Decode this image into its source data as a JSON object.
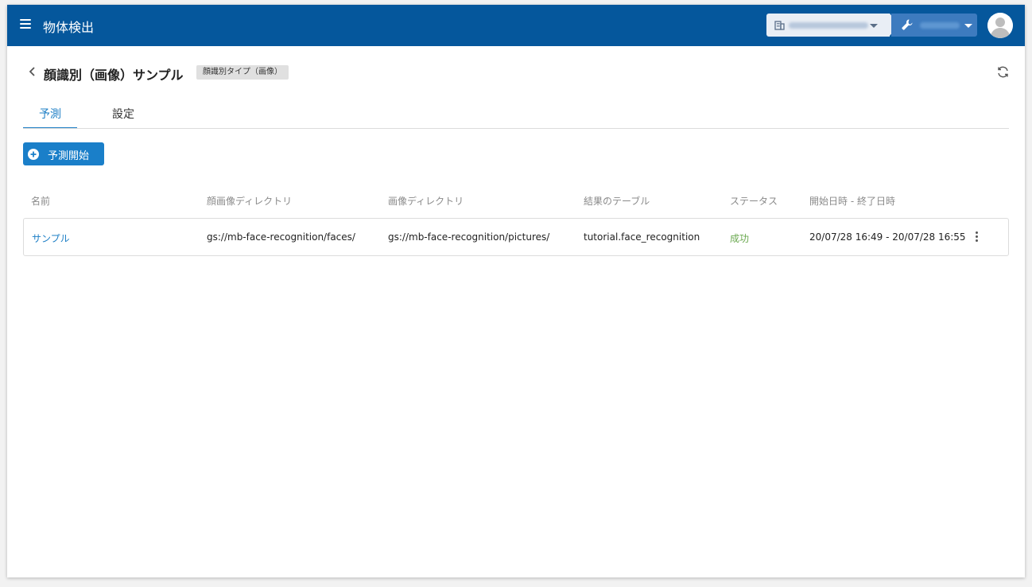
{
  "appbar": {
    "title": "物体検出",
    "icons": {
      "menu": "menu-icon",
      "org": "building-icon",
      "project": "wrench-icon",
      "avatar": "avatar-icon"
    },
    "colors": {
      "bar": "#05579c",
      "project_selector": "#3d7bbf"
    }
  },
  "page": {
    "title": "顔識別（画像）サンプル",
    "type_badge": "顔識別タイプ（画像）"
  },
  "tabs": [
    {
      "label": "予測",
      "active": true
    },
    {
      "label": "設定",
      "active": false
    }
  ],
  "actions": {
    "start_label": "予測開始"
  },
  "table": {
    "columns": [
      "名前",
      "顔画像ディレクトリ",
      "画像ディレクトリ",
      "結果のテーブル",
      "ステータス",
      "開始日時 - 終了日時"
    ],
    "rows": [
      {
        "name": "サンプル",
        "face_dir": "gs://mb-face-recognition/faces/",
        "image_dir": "gs://mb-face-recognition/pictures/",
        "result_table": "tutorial.face_recognition",
        "status": "成功",
        "period": "20/07/28 16:49 - 20/07/28 16:55"
      }
    ]
  },
  "colors": {
    "accent": "#1e7fc6",
    "success": "#6aa84f"
  }
}
